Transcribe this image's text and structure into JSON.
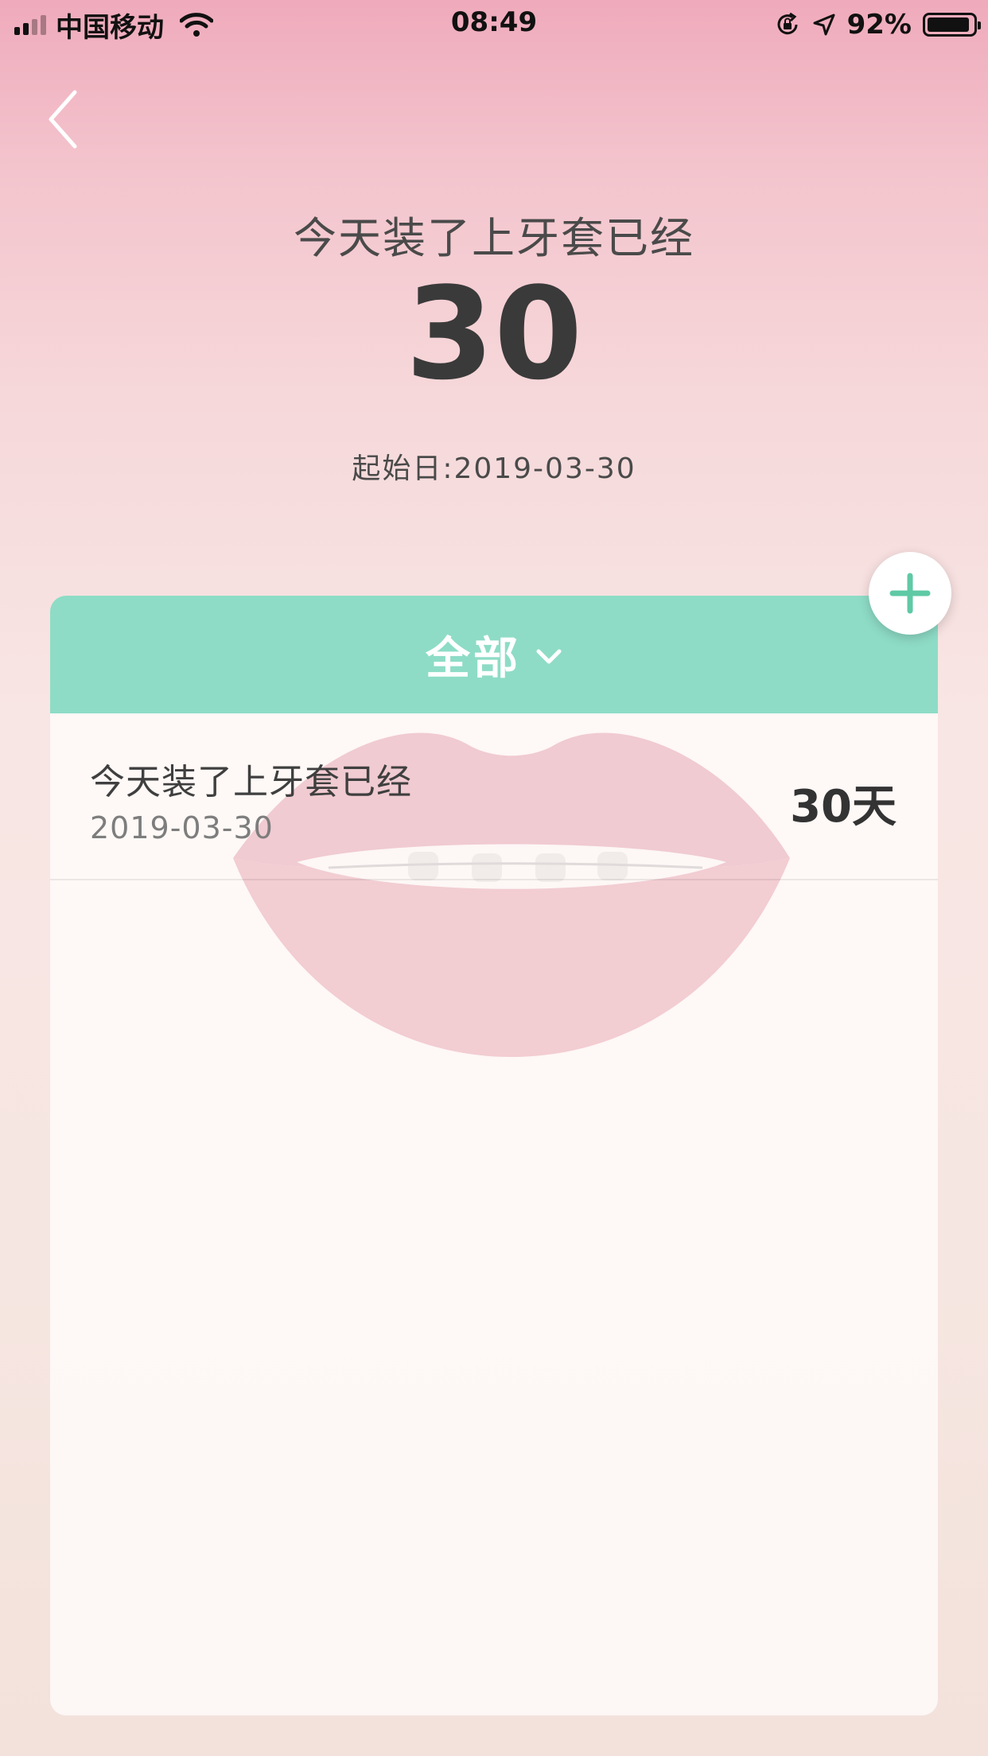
{
  "status_bar": {
    "carrier": "中国移动",
    "time": "08:49",
    "battery_percent": "92%",
    "battery_level": 0.92,
    "icons": [
      "signal-icon",
      "wifi-icon",
      "orientation-lock-icon",
      "location-icon",
      "battery-icon"
    ]
  },
  "nav": {
    "back_icon": "chevron-left-icon"
  },
  "header": {
    "title": "今天装了上牙套已经",
    "count": "30",
    "start_date": "起始日:2019-03-30"
  },
  "card": {
    "filter_label": "全部",
    "filter_icon": "chevron-down-icon",
    "add_icon": "plus-icon",
    "items": [
      {
        "title": "今天装了上牙套已经",
        "date": "2019-03-30",
        "days": "30天"
      }
    ]
  },
  "colors": {
    "accent": "#8edcc6",
    "plus": "#5fc9a6",
    "text_dark": "#3a3a3a"
  }
}
